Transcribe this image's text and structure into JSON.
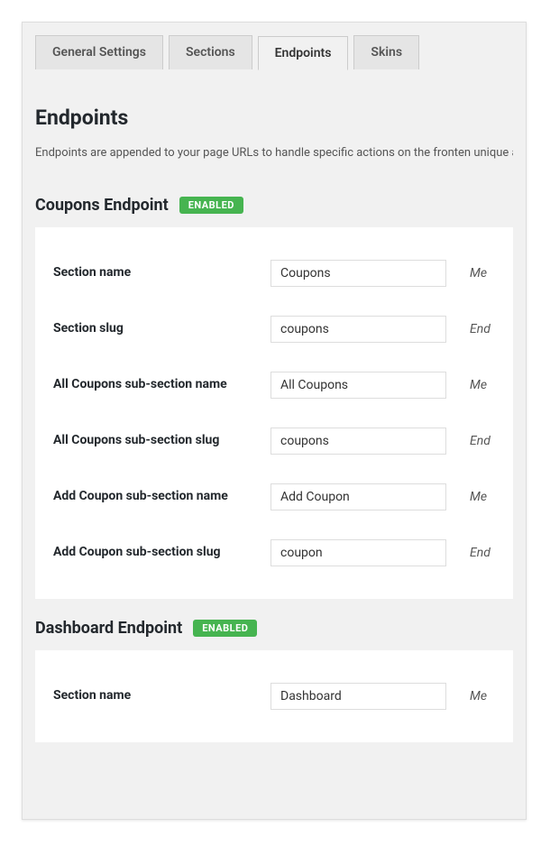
{
  "tabs": [
    {
      "label": "General Settings",
      "active": false
    },
    {
      "label": "Sections",
      "active": false
    },
    {
      "label": "Endpoints",
      "active": true
    },
    {
      "label": "Skins",
      "active": false
    }
  ],
  "page": {
    "title": "Endpoints",
    "description": "Endpoints are appended to your page URLs to handle specific actions on the fronten unique and leaving them blank will disable the endpoint."
  },
  "sections": [
    {
      "title": "Coupons Endpoint",
      "badge": "ENABLED",
      "fields": [
        {
          "label": "Section name",
          "value": "Coupons",
          "hint": "Me"
        },
        {
          "label": "Section slug",
          "value": "coupons",
          "hint": "End"
        },
        {
          "label": "All Coupons sub-section name",
          "value": "All Coupons",
          "hint": "Me"
        },
        {
          "label": "All Coupons sub-section slug",
          "value": "coupons",
          "hint": "End"
        },
        {
          "label": "Add Coupon sub-section name",
          "value": "Add Coupon",
          "hint": "Me"
        },
        {
          "label": "Add Coupon sub-section slug",
          "value": "coupon",
          "hint": "End"
        }
      ]
    },
    {
      "title": "Dashboard Endpoint",
      "badge": "ENABLED",
      "fields": [
        {
          "label": "Section name",
          "value": "Dashboard",
          "hint": "Me"
        }
      ]
    }
  ]
}
